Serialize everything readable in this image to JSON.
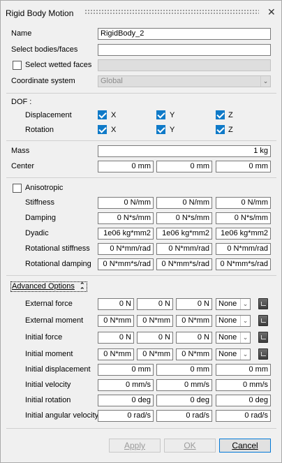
{
  "dialog": {
    "title": "Rigid Body Motion"
  },
  "general": {
    "name_label": "Name",
    "name_value": "RigidBody_2",
    "select_label": "Select bodies/faces",
    "select_value": "",
    "wetted_label": "Select wetted faces",
    "wetted_value": "",
    "coord_label": "Coordinate system",
    "coord_value": "Global"
  },
  "dof": {
    "label": "DOF :",
    "displacement_label": "Displacement",
    "rotation_label": "Rotation",
    "x": "X",
    "y": "Y",
    "z": "Z"
  },
  "mass": {
    "label": "Mass",
    "value": "1 kg"
  },
  "center": {
    "label": "Center",
    "x": "0 mm",
    "y": "0 mm",
    "z": "0 mm"
  },
  "anisotropic": {
    "label": "Anisotropic",
    "stiffness_label": "Stiffness",
    "stiffness": [
      "0 N/mm",
      "0 N/mm",
      "0 N/mm"
    ],
    "damping_label": "Damping",
    "damping": [
      "0 N*s/mm",
      "0 N*s/mm",
      "0 N*s/mm"
    ],
    "dyadic_label": "Dyadic",
    "dyadic": [
      "1e06 kg*mm2",
      "1e06 kg*mm2",
      "1e06 kg*mm2"
    ],
    "rot_stiffness_label": "Rotational stiffness",
    "rot_stiffness": [
      "0 N*mm/rad",
      "0 N*mm/rad",
      "0 N*mm/rad"
    ],
    "rot_damping_label": "Rotational damping",
    "rot_damping": [
      "0 N*mm*s/rad",
      "0 N*mm*s/rad",
      "0 N*mm*s/rad"
    ]
  },
  "advanced": {
    "label": "Advanced Options",
    "ext_force_label": "External force",
    "ext_force": [
      "0 N",
      "0 N",
      "0 N"
    ],
    "ext_force_mode": "None",
    "ext_moment_label": "External moment",
    "ext_moment": [
      "0 N*mm",
      "0 N*mm",
      "0 N*mm"
    ],
    "ext_moment_mode": "None",
    "init_force_label": "Initial force",
    "init_force": [
      "0 N",
      "0 N",
      "0 N"
    ],
    "init_force_mode": "None",
    "init_moment_label": "Initial moment",
    "init_moment": [
      "0 N*mm",
      "0 N*mm",
      "0 N*mm"
    ],
    "init_moment_mode": "None",
    "init_disp_label": "Initial displacement",
    "init_disp": [
      "0 mm",
      "0 mm",
      "0 mm"
    ],
    "init_vel_label": "Initial velocity",
    "init_vel": [
      "0 mm/s",
      "0 mm/s",
      "0 mm/s"
    ],
    "init_rot_label": "Initial rotation",
    "init_rot": [
      "0 deg",
      "0 deg",
      "0 deg"
    ],
    "init_angvel_label": "Initial angular velocity",
    "init_angvel": [
      "0 rad/s",
      "0 rad/s",
      "0 rad/s"
    ]
  },
  "buttons": {
    "apply": "Apply",
    "ok": "OK",
    "cancel": "Cancel"
  },
  "colors": {
    "accent": "#0f7ac8",
    "window_bg": "#f0f0f0"
  }
}
